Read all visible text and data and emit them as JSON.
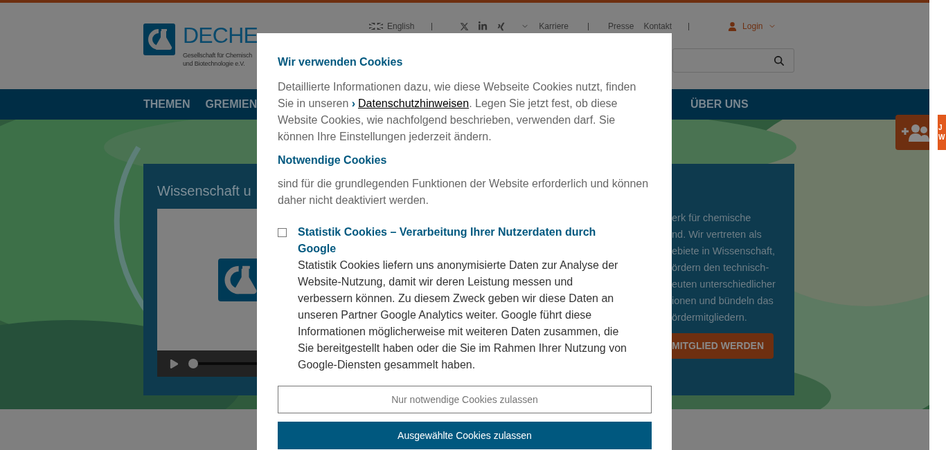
{
  "header": {
    "wordmark": "DECHE",
    "tagline": [
      "Gesellschaft für Chemisch",
      "und Biotechnologie e.V."
    ],
    "language": "English",
    "links": [
      "Karriere",
      "Presse",
      "Kontakt"
    ],
    "login": "Login"
  },
  "nav": {
    "left": [
      "THEMEN",
      "GREMIEN"
    ],
    "right": [
      "ÜBER UNS"
    ]
  },
  "hero": {
    "title": "Wissenschaft u",
    "text_lines": [
      "erk für chemische",
      "nd. Wir vertreten als",
      "ebiete in Wissenschaft,",
      "ördern den technisch-",
      "euten unterschiedlicher",
      "ionen und bündeln das",
      "ördermitgliedern."
    ],
    "button": "MITGLIED WERDEN"
  },
  "side_tab": {
    "lines": [
      "J",
      "W"
    ]
  },
  "cookie_dialog": {
    "title": "Wir verwenden Cookies",
    "intro_before": "Detaillierte Informationen dazu, wie diese Webseite Cookies nutzt, finden Sie in unseren ",
    "link_marker": "›",
    "link": "Datenschutzhinweisen",
    "intro_after": ". Legen Sie jetzt fest, ob diese Website Cookies, wie nachfolgend beschrieben, verwenden darf. Sie können Ihre Einstellungen jederzeit ändern.",
    "sections": [
      {
        "kind": "info",
        "title": "Notwendige Cookies",
        "text": "sind für die grundlegenden Funktionen der Website erforderlich und können daher nicht deaktiviert werden."
      },
      {
        "kind": "option",
        "title": "Statistik Cookies – Verarbeitung Ihrer Nutzerdaten durch Google",
        "checked": false,
        "text": "Statistik Cookies liefern uns anonymisierte Daten zur Analyse der Website-Nutzung, damit wir deren Leistung messen und verbessern können. Zu diesem Zweck geben wir diese Daten an unseren Partner Google Analytics weiter. Google führt diese Informationen möglicherweise mit weiteren Daten zusammen, die Sie bereitgestellt haben oder die Sie im Rahmen Ihrer Nutzung von Google-Diensten gesammelt haben."
      }
    ],
    "buttons": [
      {
        "kind": "outline",
        "label": "Nur notwendige Cookies zulassen"
      },
      {
        "kind": "primary",
        "label": "Ausgewählte Cookies zulassen"
      }
    ]
  }
}
